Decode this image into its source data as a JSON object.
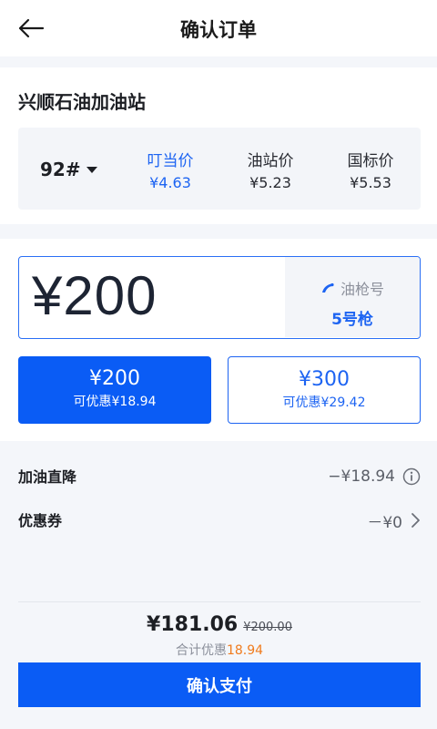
{
  "header": {
    "title": "确认订单",
    "back_icon": "arrow-left-icon"
  },
  "station": {
    "name": "兴顺石油加油站",
    "fuel_type": "92#",
    "prices": [
      {
        "label": "叮当价",
        "value": "¥4.63",
        "highlight": true
      },
      {
        "label": "油站价",
        "value": "¥5.23"
      },
      {
        "label": "国标价",
        "value": "¥5.53"
      }
    ]
  },
  "amount": {
    "value": "¥200",
    "nozzle_label": "油枪号",
    "nozzle_value": "5号枪",
    "presets": [
      {
        "amount": "¥200",
        "discount": "可优惠¥18.94",
        "selected": true
      },
      {
        "amount": "¥300",
        "discount": "可优惠¥29.42",
        "selected": false
      }
    ]
  },
  "discounts": {
    "direct_label": "加油直降",
    "direct_value": "−¥18.94",
    "coupon_label": "优惠券",
    "coupon_value": "－¥0"
  },
  "summary": {
    "total": "¥181.06",
    "original": "¥200.00",
    "discount_prefix": "合计优惠",
    "discount_amount": "18.94",
    "pay_label": "确认支付"
  },
  "colors": {
    "accent": "#0a5cf5",
    "highlight": "#1d64f2",
    "discount": "#f07b1d"
  }
}
